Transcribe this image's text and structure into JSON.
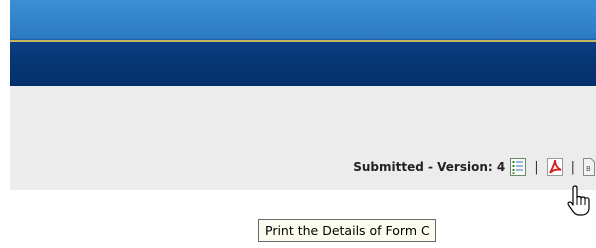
{
  "status": {
    "label": "Submitted - Version: 4"
  },
  "toolbar": {
    "separator": "|",
    "icons": [
      "details-list-icon",
      "pdf-icon",
      "print-details-icon"
    ]
  },
  "tooltip": {
    "text": "Print the Details of Form C"
  },
  "colors": {
    "banner_top": "#3b8fd4",
    "banner_bottom": "#04306a",
    "banner_accent_line": "#c9b661",
    "toolbar_bg": "#ececec",
    "tooltip_bg": "#fbfbef"
  }
}
